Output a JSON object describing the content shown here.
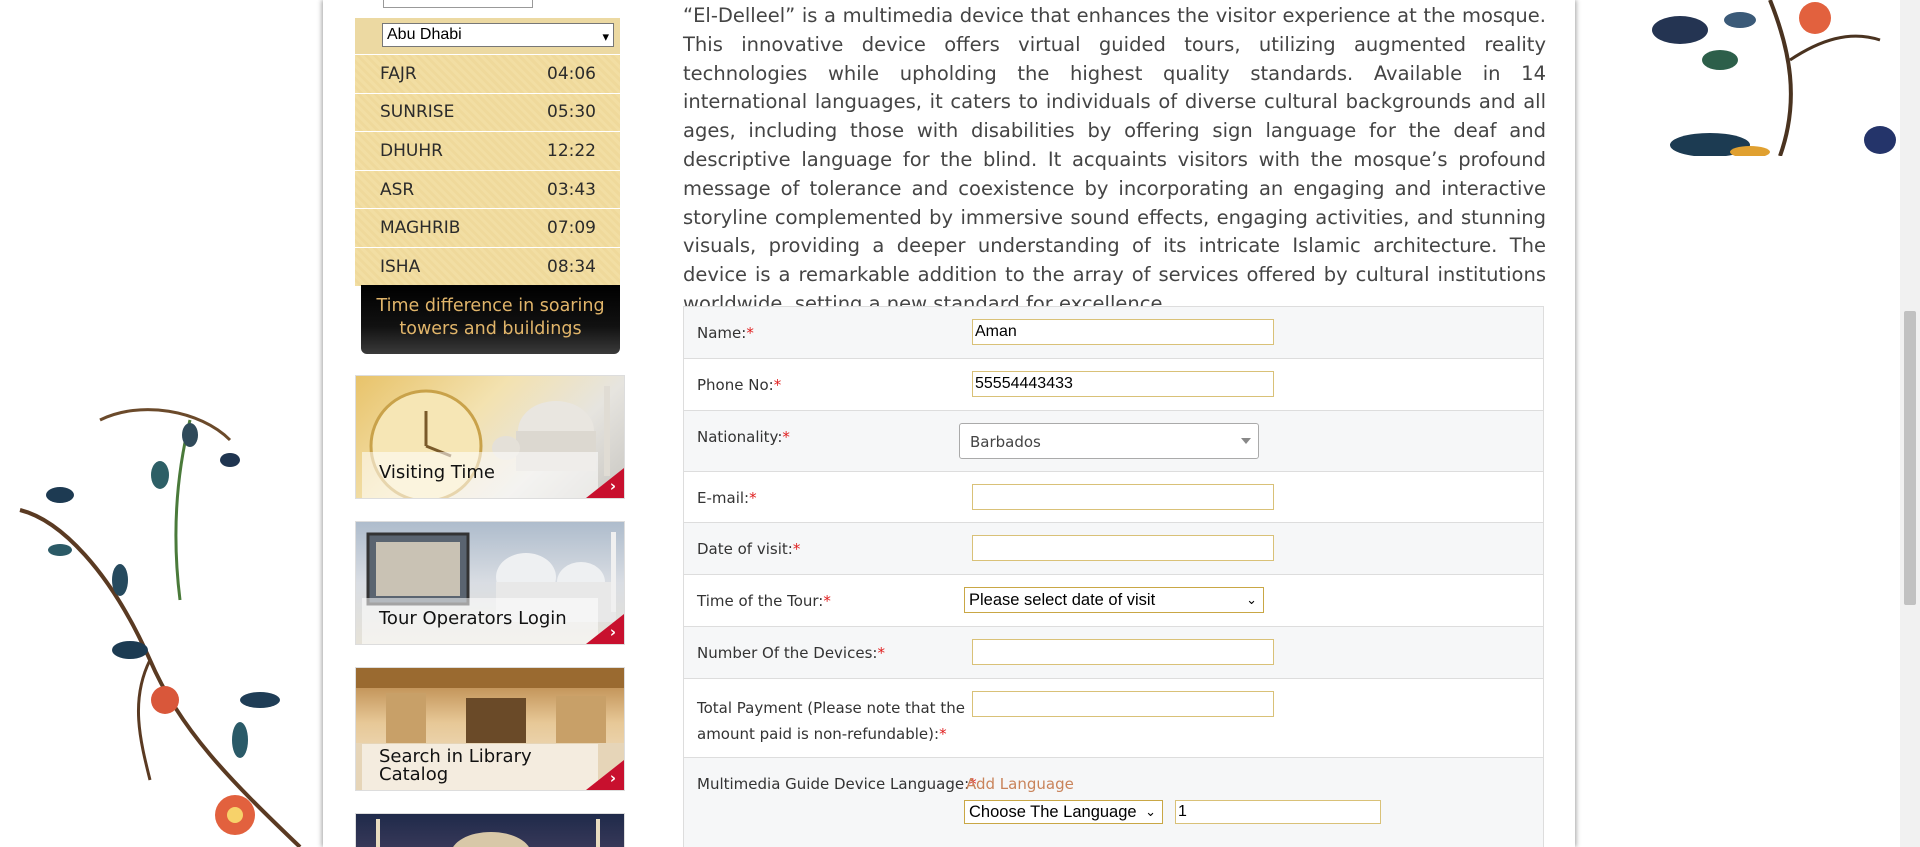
{
  "prayer": {
    "city_input_value": "Abu Dhabi",
    "city_select_value": "Abu Dhabi",
    "times": [
      {
        "name": "FAJR",
        "time": "04:06"
      },
      {
        "name": "SUNRISE",
        "time": "05:30"
      },
      {
        "name": "DHUHR",
        "time": "12:22"
      },
      {
        "name": "ASR",
        "time": "03:43"
      },
      {
        "name": "MAGHRIB",
        "time": "07:09"
      },
      {
        "name": "ISHA",
        "time": "08:34"
      }
    ],
    "time_difference": "Time difference in soaring towers and buildings"
  },
  "promos": [
    {
      "label": "Visiting Time"
    },
    {
      "label": "Tour Operators Login"
    },
    {
      "label": "Search in Library Catalog"
    }
  ],
  "content": {
    "paragraph": "“El-Delleel” is a multimedia device that enhances the visitor experience at the mosque. This innovative device offers virtual guided tours, utilizing augmented reality technologies while upholding the highest quality standards. Available in 14 international languages, it caters to individuals of diverse cultural backgrounds and all ages, including those with disabilities by offering sign language for the deaf and descriptive language for the blind. It acquaints visitors with the mosque’s profound message of tolerance and coexistence by incorporating an engaging and interactive storyline complemented by immersive sound effects, engaging activities, and stunning visuals, providing a deeper understanding of its intricate Islamic architecture. The device is a remarkable addition to the array of services offered by cultural institutions worldwide, setting a new standard for excellence."
  },
  "form": {
    "required_mark": "*",
    "name": {
      "label": "Name:",
      "value": "Aman"
    },
    "phone": {
      "label": "Phone No:",
      "value": "55554443433"
    },
    "nationality": {
      "label": "Nationality:",
      "value": "Barbados"
    },
    "email": {
      "label": "E-mail:",
      "value": ""
    },
    "date": {
      "label": "Date of visit:",
      "value": ""
    },
    "tour_time": {
      "label": "Time of the Tour:",
      "value": "Please select date of visit"
    },
    "devices": {
      "label": "Number Of the Devices:",
      "value": ""
    },
    "payment": {
      "label_line1": "Total Payment (Please note that the",
      "label_line2": "amount paid is non-refundable):",
      "value": ""
    },
    "language": {
      "label": "Multimedia Guide Device Language:",
      "add_link": "Add Language",
      "select_value": "Choose The Language",
      "qty_value": "1"
    }
  },
  "colors": {
    "accent_gold": "#e1b56a",
    "required_red": "#e02020",
    "link": "#c9835a",
    "promo_red": "#c8102e"
  }
}
